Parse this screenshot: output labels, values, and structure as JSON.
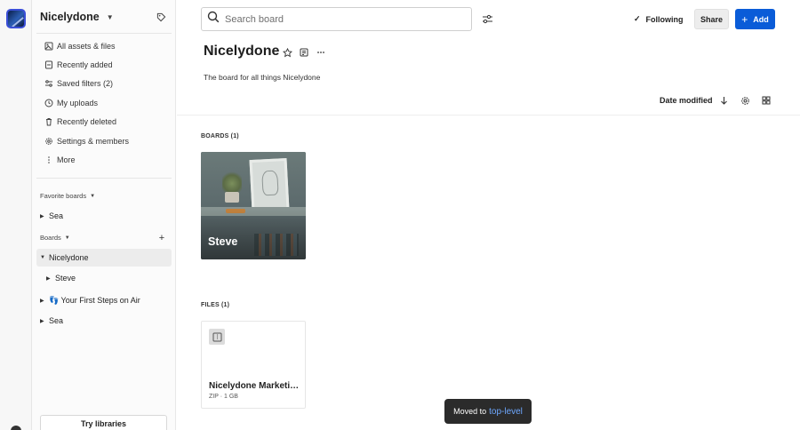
{
  "workspace": {
    "logo": "workspace-logo"
  },
  "sidebar": {
    "title": "Nicelydone",
    "nav": [
      {
        "label": "All assets & files",
        "icon": "assets-icon"
      },
      {
        "label": "Recently added",
        "icon": "recent-added-icon"
      },
      {
        "label": "Saved filters (2)",
        "icon": "saved-filters-icon"
      },
      {
        "label": "My uploads",
        "icon": "clock-icon"
      },
      {
        "label": "Recently deleted",
        "icon": "trash-icon"
      },
      {
        "label": "Settings & members",
        "icon": "gear-icon"
      },
      {
        "label": "More",
        "icon": "more-vertical-icon"
      }
    ],
    "favorites_label": "Favorite boards",
    "favorites": [
      {
        "label": "Sea"
      }
    ],
    "boards_label": "Boards",
    "boards": [
      {
        "label": "Nicelydone",
        "expanded": true
      },
      {
        "label": "Steve"
      },
      {
        "label": "👣 Your First Steps on Air"
      },
      {
        "label": "Sea"
      }
    ],
    "try_button": "Try libraries"
  },
  "header": {
    "search_placeholder": "Search board",
    "following_label": "Following",
    "share_label": "Share",
    "add_label": "Add"
  },
  "board": {
    "title": "Nicelydone",
    "description": "The board for all things Nicelydone",
    "sort_label": "Date modified",
    "boards_section": "BOARDS (1)",
    "files_section": "FILES (1)",
    "sub_boards": [
      {
        "name": "Steve"
      }
    ],
    "files": [
      {
        "name": "Nicelydone Marketing Assets",
        "meta": "ZIP · 1 GB"
      }
    ]
  },
  "toast": {
    "text": "Moved to",
    "link": "top-level"
  },
  "colors": {
    "accent": "#0a5cd8",
    "toast_bg": "#2b2b2b",
    "toast_link": "#6ea8ff"
  }
}
